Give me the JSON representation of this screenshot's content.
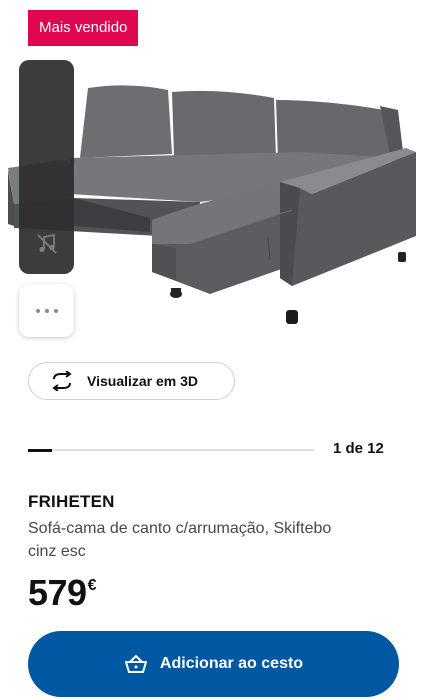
{
  "badge": {
    "label": "Mais vendido"
  },
  "product_image": {
    "alt": "FRIHETEN sofa-cama de canto"
  },
  "side_panel": {
    "icon": "music-off-icon"
  },
  "more_options": {
    "icon": "more-horizontal-icon"
  },
  "view3d": {
    "label": "Visualizar em 3D",
    "icon": "rotate-3d-icon"
  },
  "gallery": {
    "current": 1,
    "total": 12,
    "indicator": "1 de 12"
  },
  "product": {
    "name": "FRIHETEN",
    "description": "Sofá-cama de canto c/arrumação, Skiftebo cinz esc",
    "price": "579",
    "currency": "€"
  },
  "cta": {
    "label": "Adicionar ao cesto",
    "icon": "cart-icon"
  },
  "colors": {
    "badge": "#e00751",
    "cta": "#0058a3",
    "text": "#111111",
    "sofa": "#5a5b5e"
  }
}
